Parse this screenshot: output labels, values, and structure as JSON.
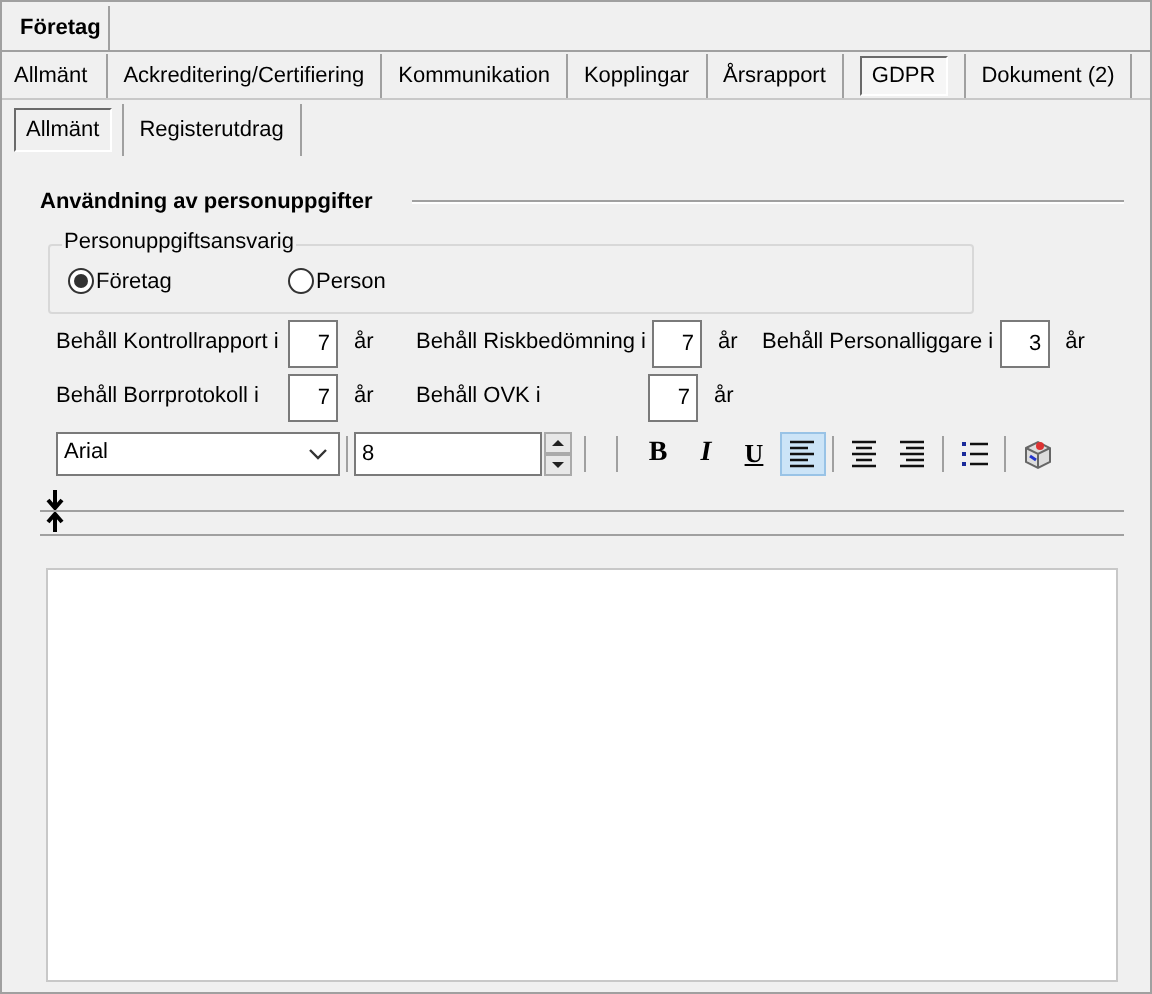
{
  "top_tab": {
    "label": "Företag",
    "selected": true
  },
  "tabs": [
    {
      "label": "Allmänt",
      "selected": false
    },
    {
      "label": "Ackreditering/Certifiering",
      "selected": false
    },
    {
      "label": "Kommunikation",
      "selected": false
    },
    {
      "label": "Kopplingar",
      "selected": false
    },
    {
      "label": "Årsrapport",
      "selected": false
    },
    {
      "label": "GDPR",
      "selected": true
    },
    {
      "label": "Dokument (2)",
      "selected": false
    }
  ],
  "subtabs": [
    {
      "label": "Allmänt",
      "selected": true
    },
    {
      "label": "Registerutdrag",
      "selected": false
    }
  ],
  "section_title": "Användning av personuppgifter",
  "responsible": {
    "legend": "Personuppgiftsansvarig",
    "options": [
      {
        "label": "Företag",
        "selected": true
      },
      {
        "label": "Person",
        "selected": false
      }
    ]
  },
  "retention_rows": [
    [
      {
        "label": "Behåll Kontrollrapport i",
        "value": "7",
        "unit": "år"
      },
      {
        "label": "Behåll Riskbedömning i",
        "value": "7",
        "unit": "år"
      },
      {
        "label": "Behåll Personalliggare i",
        "value": "3",
        "unit": "år"
      }
    ],
    [
      {
        "label": "Behåll Borrprotokoll i",
        "value": "7",
        "unit": "år"
      },
      {
        "label": "Behåll OVK i",
        "value": "7",
        "unit": "år"
      }
    ]
  ],
  "toolbar": {
    "font": "Arial",
    "size": "8",
    "buttons": [
      {
        "kind": "bold",
        "label": "B",
        "selected": false
      },
      {
        "kind": "italic",
        "label": "I",
        "selected": false
      },
      {
        "kind": "underline",
        "label": "U",
        "selected": false
      },
      {
        "kind": "align-left",
        "selected": true
      },
      {
        "kind": "align-center",
        "selected": false
      },
      {
        "kind": "align-right",
        "selected": false
      },
      {
        "kind": "list",
        "selected": false
      },
      {
        "kind": "insert",
        "selected": false
      }
    ]
  }
}
